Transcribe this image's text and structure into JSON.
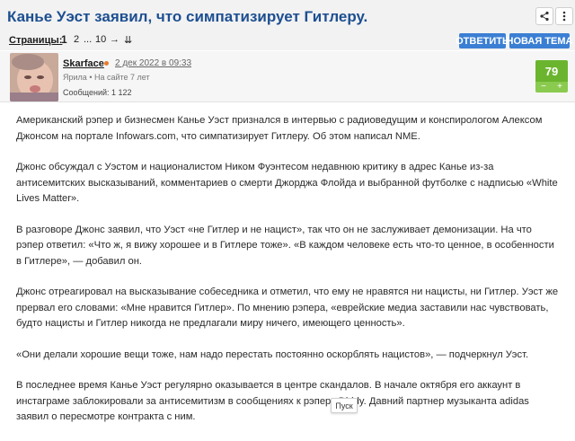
{
  "thread": {
    "title": "Канье Уэст заявил, что симпатизирует Гитлеру."
  },
  "toolbar": {
    "share_icon": "share-icon",
    "menu_icon": "vertical-dots-icon"
  },
  "pagination": {
    "label": "Страницы:",
    "current": "1",
    "pages": [
      "2",
      "...",
      "10"
    ],
    "next": "→",
    "last": "⇊"
  },
  "actions": {
    "reply": "ОТВЕТИТЬ",
    "new_topic": "НОВАЯ ТЕМА"
  },
  "post": {
    "author": "Skarface",
    "date": "2 дек 2022 в 09:33",
    "location": "Ярила",
    "tenure": "На сайте 7 лет",
    "messages": "Сообщений: 1 122",
    "rating": "79",
    "rating_minus": "−",
    "rating_plus": "+",
    "paragraphs": [
      "Американский рэпер и бизнесмен Канье Уэст признался в интервью с радиоведущим и конспирологом Алексом Джонсом на портале Infowars.com, что симпатизирует Гитлеру. Об этом написал NME.",
      "Джонс обсуждал с Уэстом и националистом Ником Фуэнтесом недавнюю критику в адрес Канье из-за антисемитских высказываний, комментариев о смерти Джорджа Флойда и выбранной футболке с надписью «White Lives Matter».",
      "В разговоре Джонс заявил, что Уэст «не Гитлер и не нацист», так что он не заслуживает демонизации. На что рэпер ответил: «Что ж, я вижу хорошее и в Гитлере тоже». «В каждом человеке есть что-то ценное, в особенности в Гитлере», — добавил он.",
      "Джонс отреагировал на высказывание собеседника и отметил, что ему не нравятся ни нацисты, ни Гитлер. Уэст же прервал его словами: «Мне нравится Гитлер». По мнению рэпера, «еврейские медиа заставили нас чувствовать, будто нацисты и Гитлер никогда не предлагали миру ничего, имеющего ценность».",
      "«Они делали хорошие вещи тоже, нам надо перестать постоянно оскорблять нацистов», — подчеркнул Уэст.",
      "В последнее время Канье Уэст регулярно оказывается в центре скандалов. В начале октября его аккаунт в инстаграме заблокировали за антисемитизм в сообщениях к рэперу Diddy. Давний партнер музыканта adidas заявил о пересмотре контракта с ним."
    ]
  },
  "tooltip": {
    "text": "Пуск"
  },
  "colors": {
    "title": "#1d4f91",
    "button": "#3b7fd4",
    "rating": "#6bb52e",
    "online": "#e97b2a"
  }
}
